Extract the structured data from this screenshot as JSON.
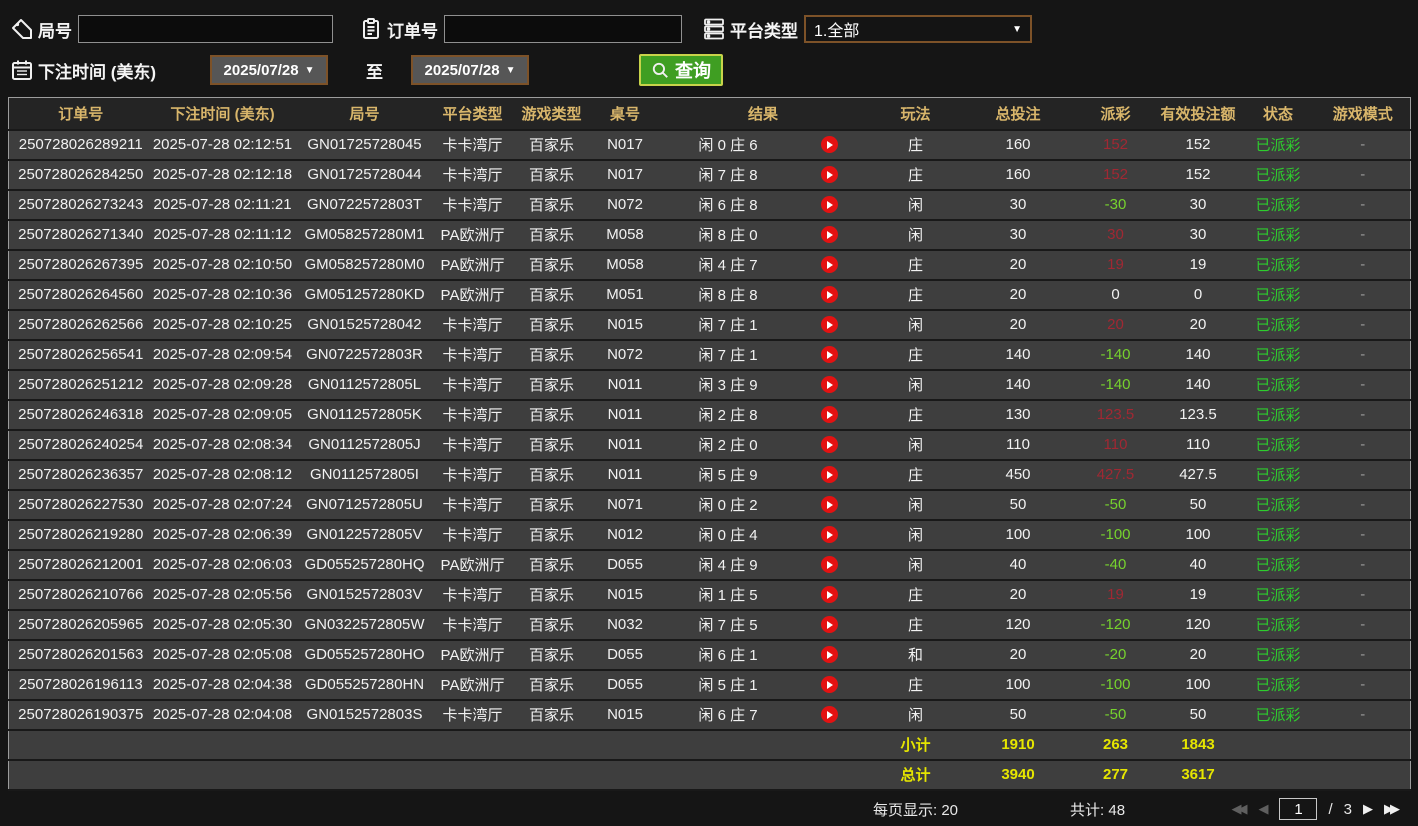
{
  "toolbar": {
    "game_no_label": "局号",
    "game_no_value": "",
    "order_no_label": "订单号",
    "order_no_value": "",
    "platform_label": "平台类型",
    "platform_value": "1.全部",
    "bet_time_label": "下注时间 (美东)",
    "date_from": "2025/07/28",
    "to_label": "至",
    "date_to": "2025/07/28",
    "search_label": "查询"
  },
  "icons": {
    "game_no": "tag-icon",
    "order_no": "clipboard-icon",
    "platform": "server-icon",
    "bet_time": "calendar-icon",
    "search": "magnifier-icon",
    "result_play": "play-icon",
    "dropdown_arrow": "▼",
    "first_page": "◀◀",
    "prev_page": "◀",
    "next_page": "▶",
    "last_page": "▶▶"
  },
  "colors": {
    "header_gold": "#d9b66b",
    "win_red": "#a02833",
    "loss_green": "#76d22e",
    "status_green": "#2ecc2e",
    "summary_yellow": "#e6e600",
    "button_green": "#3f9e22",
    "button_border": "#c8d34a",
    "brown_border": "#7d5228",
    "row_bg": "#3e3e3e"
  },
  "table": {
    "headers": [
      "订单号",
      "下注时间 (美东)",
      "局号",
      "平台类型",
      "游戏类型",
      "桌号",
      "结果",
      "玩法",
      "总投注",
      "派彩",
      "有效投注额",
      "状态",
      "游戏模式"
    ],
    "rows": [
      {
        "order_no": "250728026289211",
        "bet_time": "2025-07-28 02:12:51",
        "game_no": "GN01725728045",
        "platform": "卡卡湾厅",
        "game_type": "百家乐",
        "table_no": "N017",
        "result": "闲 0 庄 6",
        "bet_side": "庄",
        "total_bet": "160",
        "payout": "152",
        "payout_type": "win",
        "valid_bet": "152",
        "status": "已派彩",
        "mode": "-"
      },
      {
        "order_no": "250728026284250",
        "bet_time": "2025-07-28 02:12:18",
        "game_no": "GN01725728044",
        "platform": "卡卡湾厅",
        "game_type": "百家乐",
        "table_no": "N017",
        "result": "闲 7 庄 8",
        "bet_side": "庄",
        "total_bet": "160",
        "payout": "152",
        "payout_type": "win",
        "valid_bet": "152",
        "status": "已派彩",
        "mode": "-"
      },
      {
        "order_no": "250728026273243",
        "bet_time": "2025-07-28 02:11:21",
        "game_no": "GN0722572803T",
        "platform": "卡卡湾厅",
        "game_type": "百家乐",
        "table_no": "N072",
        "result": "闲 6 庄 8",
        "bet_side": "闲",
        "total_bet": "30",
        "payout": "-30",
        "payout_type": "loss",
        "valid_bet": "30",
        "status": "已派彩",
        "mode": "-"
      },
      {
        "order_no": "250728026271340",
        "bet_time": "2025-07-28 02:11:12",
        "game_no": "GM058257280M1",
        "platform": "PA欧洲厅",
        "game_type": "百家乐",
        "table_no": "M058",
        "result": "闲 8 庄 0",
        "bet_side": "闲",
        "total_bet": "30",
        "payout": "30",
        "payout_type": "win",
        "valid_bet": "30",
        "status": "已派彩",
        "mode": "-"
      },
      {
        "order_no": "250728026267395",
        "bet_time": "2025-07-28 02:10:50",
        "game_no": "GM058257280M0",
        "platform": "PA欧洲厅",
        "game_type": "百家乐",
        "table_no": "M058",
        "result": "闲 4 庄 7",
        "bet_side": "庄",
        "total_bet": "20",
        "payout": "19",
        "payout_type": "win",
        "valid_bet": "19",
        "status": "已派彩",
        "mode": "-"
      },
      {
        "order_no": "250728026264560",
        "bet_time": "2025-07-28 02:10:36",
        "game_no": "GM051257280KD",
        "platform": "PA欧洲厅",
        "game_type": "百家乐",
        "table_no": "M051",
        "result": "闲 8 庄 8",
        "bet_side": "庄",
        "total_bet": "20",
        "payout": "0",
        "payout_type": "zero",
        "valid_bet": "0",
        "status": "已派彩",
        "mode": "-"
      },
      {
        "order_no": "250728026262566",
        "bet_time": "2025-07-28 02:10:25",
        "game_no": "GN01525728042",
        "platform": "卡卡湾厅",
        "game_type": "百家乐",
        "table_no": "N015",
        "result": "闲 7 庄 1",
        "bet_side": "闲",
        "total_bet": "20",
        "payout": "20",
        "payout_type": "win",
        "valid_bet": "20",
        "status": "已派彩",
        "mode": "-"
      },
      {
        "order_no": "250728026256541",
        "bet_time": "2025-07-28 02:09:54",
        "game_no": "GN0722572803R",
        "platform": "卡卡湾厅",
        "game_type": "百家乐",
        "table_no": "N072",
        "result": "闲 7 庄 1",
        "bet_side": "庄",
        "total_bet": "140",
        "payout": "-140",
        "payout_type": "loss",
        "valid_bet": "140",
        "status": "已派彩",
        "mode": "-"
      },
      {
        "order_no": "250728026251212",
        "bet_time": "2025-07-28 02:09:28",
        "game_no": "GN0112572805L",
        "platform": "卡卡湾厅",
        "game_type": "百家乐",
        "table_no": "N011",
        "result": "闲 3 庄 9",
        "bet_side": "闲",
        "total_bet": "140",
        "payout": "-140",
        "payout_type": "loss",
        "valid_bet": "140",
        "status": "已派彩",
        "mode": "-"
      },
      {
        "order_no": "250728026246318",
        "bet_time": "2025-07-28 02:09:05",
        "game_no": "GN0112572805K",
        "platform": "卡卡湾厅",
        "game_type": "百家乐",
        "table_no": "N011",
        "result": "闲 2 庄 8",
        "bet_side": "庄",
        "total_bet": "130",
        "payout": "123.5",
        "payout_type": "win",
        "valid_bet": "123.5",
        "status": "已派彩",
        "mode": "-"
      },
      {
        "order_no": "250728026240254",
        "bet_time": "2025-07-28 02:08:34",
        "game_no": "GN0112572805J",
        "platform": "卡卡湾厅",
        "game_type": "百家乐",
        "table_no": "N011",
        "result": "闲 2 庄 0",
        "bet_side": "闲",
        "total_bet": "110",
        "payout": "110",
        "payout_type": "win",
        "valid_bet": "110",
        "status": "已派彩",
        "mode": "-"
      },
      {
        "order_no": "250728026236357",
        "bet_time": "2025-07-28 02:08:12",
        "game_no": "GN0112572805I",
        "platform": "卡卡湾厅",
        "game_type": "百家乐",
        "table_no": "N011",
        "result": "闲 5 庄 9",
        "bet_side": "庄",
        "total_bet": "450",
        "payout": "427.5",
        "payout_type": "win",
        "valid_bet": "427.5",
        "status": "已派彩",
        "mode": "-"
      },
      {
        "order_no": "250728026227530",
        "bet_time": "2025-07-28 02:07:24",
        "game_no": "GN0712572805U",
        "platform": "卡卡湾厅",
        "game_type": "百家乐",
        "table_no": "N071",
        "result": "闲 0 庄 2",
        "bet_side": "闲",
        "total_bet": "50",
        "payout": "-50",
        "payout_type": "loss",
        "valid_bet": "50",
        "status": "已派彩",
        "mode": "-"
      },
      {
        "order_no": "250728026219280",
        "bet_time": "2025-07-28 02:06:39",
        "game_no": "GN0122572805V",
        "platform": "卡卡湾厅",
        "game_type": "百家乐",
        "table_no": "N012",
        "result": "闲 0 庄 4",
        "bet_side": "闲",
        "total_bet": "100",
        "payout": "-100",
        "payout_type": "loss",
        "valid_bet": "100",
        "status": "已派彩",
        "mode": "-"
      },
      {
        "order_no": "250728026212001",
        "bet_time": "2025-07-28 02:06:03",
        "game_no": "GD055257280HQ",
        "platform": "PA欧洲厅",
        "game_type": "百家乐",
        "table_no": "D055",
        "result": "闲 4 庄 9",
        "bet_side": "闲",
        "total_bet": "40",
        "payout": "-40",
        "payout_type": "loss",
        "valid_bet": "40",
        "status": "已派彩",
        "mode": "-"
      },
      {
        "order_no": "250728026210766",
        "bet_time": "2025-07-28 02:05:56",
        "game_no": "GN0152572803V",
        "platform": "卡卡湾厅",
        "game_type": "百家乐",
        "table_no": "N015",
        "result": "闲 1 庄 5",
        "bet_side": "庄",
        "total_bet": "20",
        "payout": "19",
        "payout_type": "win",
        "valid_bet": "19",
        "status": "已派彩",
        "mode": "-"
      },
      {
        "order_no": "250728026205965",
        "bet_time": "2025-07-28 02:05:30",
        "game_no": "GN0322572805W",
        "platform": "卡卡湾厅",
        "game_type": "百家乐",
        "table_no": "N032",
        "result": "闲 7 庄 5",
        "bet_side": "庄",
        "total_bet": "120",
        "payout": "-120",
        "payout_type": "loss",
        "valid_bet": "120",
        "status": "已派彩",
        "mode": "-"
      },
      {
        "order_no": "250728026201563",
        "bet_time": "2025-07-28 02:05:08",
        "game_no": "GD055257280HO",
        "platform": "PA欧洲厅",
        "game_type": "百家乐",
        "table_no": "D055",
        "result": "闲 6 庄 1",
        "bet_side": "和",
        "total_bet": "20",
        "payout": "-20",
        "payout_type": "loss",
        "valid_bet": "20",
        "status": "已派彩",
        "mode": "-"
      },
      {
        "order_no": "250728026196113",
        "bet_time": "2025-07-28 02:04:38",
        "game_no": "GD055257280HN",
        "platform": "PA欧洲厅",
        "game_type": "百家乐",
        "table_no": "D055",
        "result": "闲 5 庄 1",
        "bet_side": "庄",
        "total_bet": "100",
        "payout": "-100",
        "payout_type": "loss",
        "valid_bet": "100",
        "status": "已派彩",
        "mode": "-"
      },
      {
        "order_no": "250728026190375",
        "bet_time": "2025-07-28 02:04:08",
        "game_no": "GN0152572803S",
        "platform": "卡卡湾厅",
        "game_type": "百家乐",
        "table_no": "N015",
        "result": "闲 6 庄 7",
        "bet_side": "闲",
        "total_bet": "50",
        "payout": "-50",
        "payout_type": "loss",
        "valid_bet": "50",
        "status": "已派彩",
        "mode": "-"
      }
    ],
    "subtotal": {
      "label": "小计",
      "total_bet": "1910",
      "payout": "263",
      "valid_bet": "1843"
    },
    "total": {
      "label": "总计",
      "total_bet": "3940",
      "payout": "277",
      "valid_bet": "3617"
    }
  },
  "pagination": {
    "per_page_label": "每页显示:",
    "per_page_value": "20",
    "total_label": "共计:",
    "total_value": "48",
    "current_page": "1",
    "page_sep": "/",
    "total_pages": "3"
  }
}
